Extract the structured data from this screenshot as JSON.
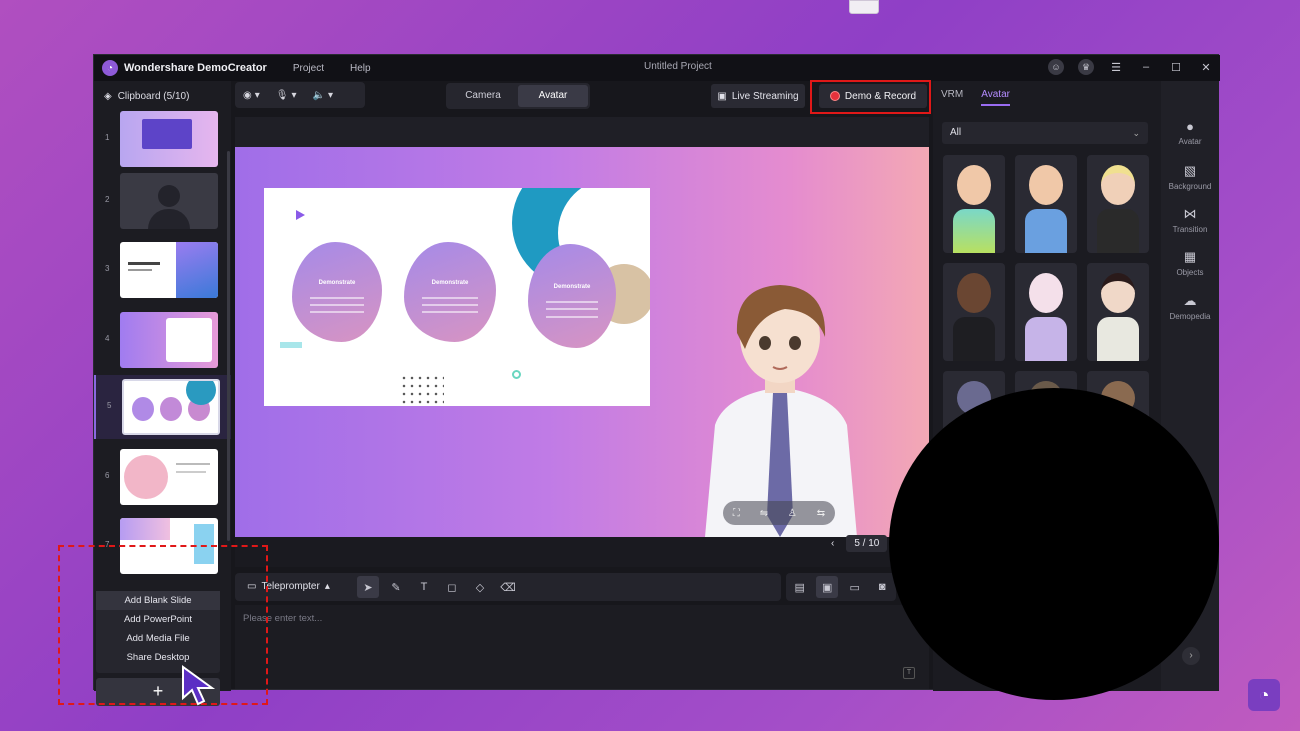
{
  "window": {
    "app_title": "Wondershare DemoCreator",
    "menu": [
      "Project",
      "Help"
    ],
    "document_title": "Untitled Project"
  },
  "clipboard": {
    "header": "Clipboard (5/10)",
    "slide_numbers": [
      "1",
      "2",
      "3",
      "4",
      "5",
      "6",
      "7"
    ],
    "add_menu": [
      "Add Blank Slide",
      "Add PowerPoint",
      "Add Media File",
      "Share Desktop"
    ],
    "add_button": "+"
  },
  "toolbar": {
    "modes": [
      "Camera",
      "Avatar"
    ],
    "active_mode": "Avatar",
    "live_streaming": "Live Streaming",
    "demo_record": "Demo & Record"
  },
  "slide": {
    "blob_titles": [
      "Demonstrate",
      "Demonstrate",
      "Demonstrate"
    ]
  },
  "pager": {
    "current": "5 / 10"
  },
  "teleprompter": {
    "label": "Teleprompter",
    "placeholder": "Please enter text..."
  },
  "avatar_panel": {
    "tabs": [
      "VRM",
      "Avatar"
    ],
    "active_tab": "Avatar",
    "filter": "All"
  },
  "side_nav": [
    "Avatar",
    "Background",
    "Transition",
    "Objects",
    "Demopedia"
  ],
  "colors": {
    "accent": "#9a6cf2",
    "highlight_frame": "#e01818",
    "record": "#e6323c"
  }
}
